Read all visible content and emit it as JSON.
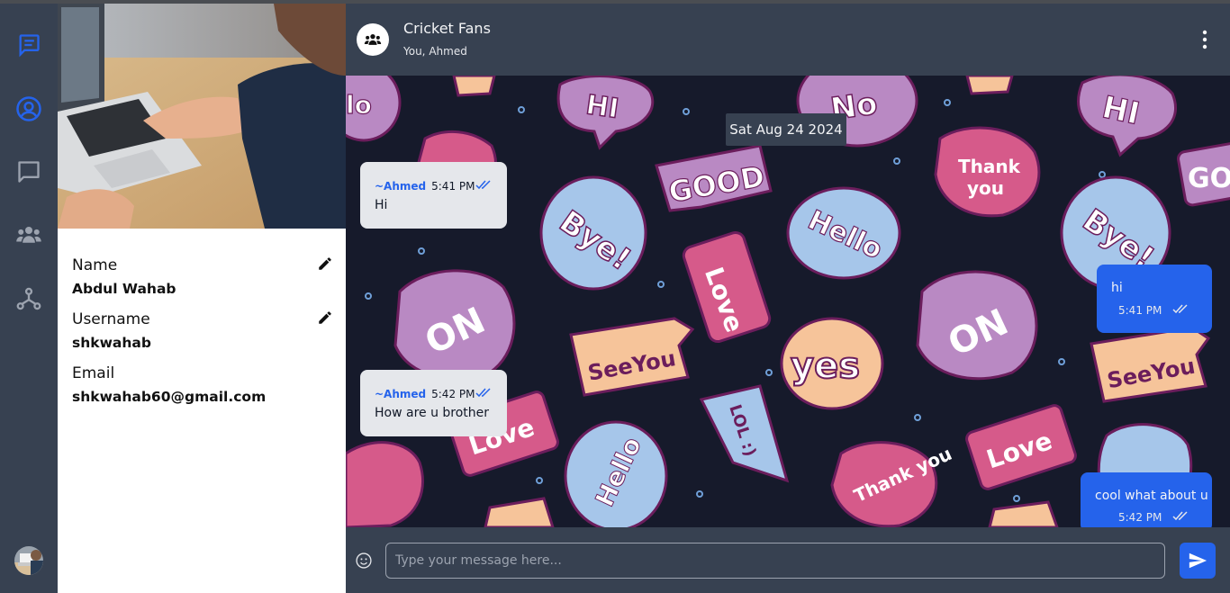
{
  "sidebar_rail": {
    "icons": [
      "chats-icon",
      "profile-icon",
      "message-icon",
      "groups-icon",
      "network-icon"
    ],
    "active": "profile-icon"
  },
  "profile": {
    "fields": [
      {
        "label": "Name",
        "value": "Abdul Wahab",
        "editable": true
      },
      {
        "label": "Username",
        "value": "shkwahab",
        "editable": true
      },
      {
        "label": "Email",
        "value": "shkwahab60@gmail.com",
        "editable": false
      }
    ]
  },
  "chat": {
    "title": "Cricket Fans",
    "members": "You, Ahmed",
    "date_label": "Sat Aug 24 2024",
    "messages": [
      {
        "direction": "in",
        "sender": "~Ahmed",
        "time": "5:41 PM",
        "text": "Hi"
      },
      {
        "direction": "out",
        "time": "5:41 PM",
        "text": "hi"
      },
      {
        "direction": "in",
        "sender": "~Ahmed",
        "time": "5:42 PM",
        "text": "How are u brother"
      },
      {
        "direction": "out",
        "time": "5:42 PM",
        "text": "cool what about u"
      }
    ],
    "composer": {
      "placeholder": "Type your message here..."
    }
  },
  "wallpaper_words": [
    "HI",
    "NO",
    "GOOD",
    "Thank you",
    "Bye!",
    "Hello",
    "Love",
    "ON",
    "See You",
    "Yes",
    "LOL :)",
    "Love",
    "Hello",
    "Thank you",
    "See You",
    "Bye!",
    "HI",
    "Love",
    "ON",
    "Thank you",
    "GO"
  ],
  "colors": {
    "rail": "#374151",
    "accent": "#2563eb",
    "wallpaper": "#161a2b",
    "incoming_bubble": "#e5e7eb"
  }
}
